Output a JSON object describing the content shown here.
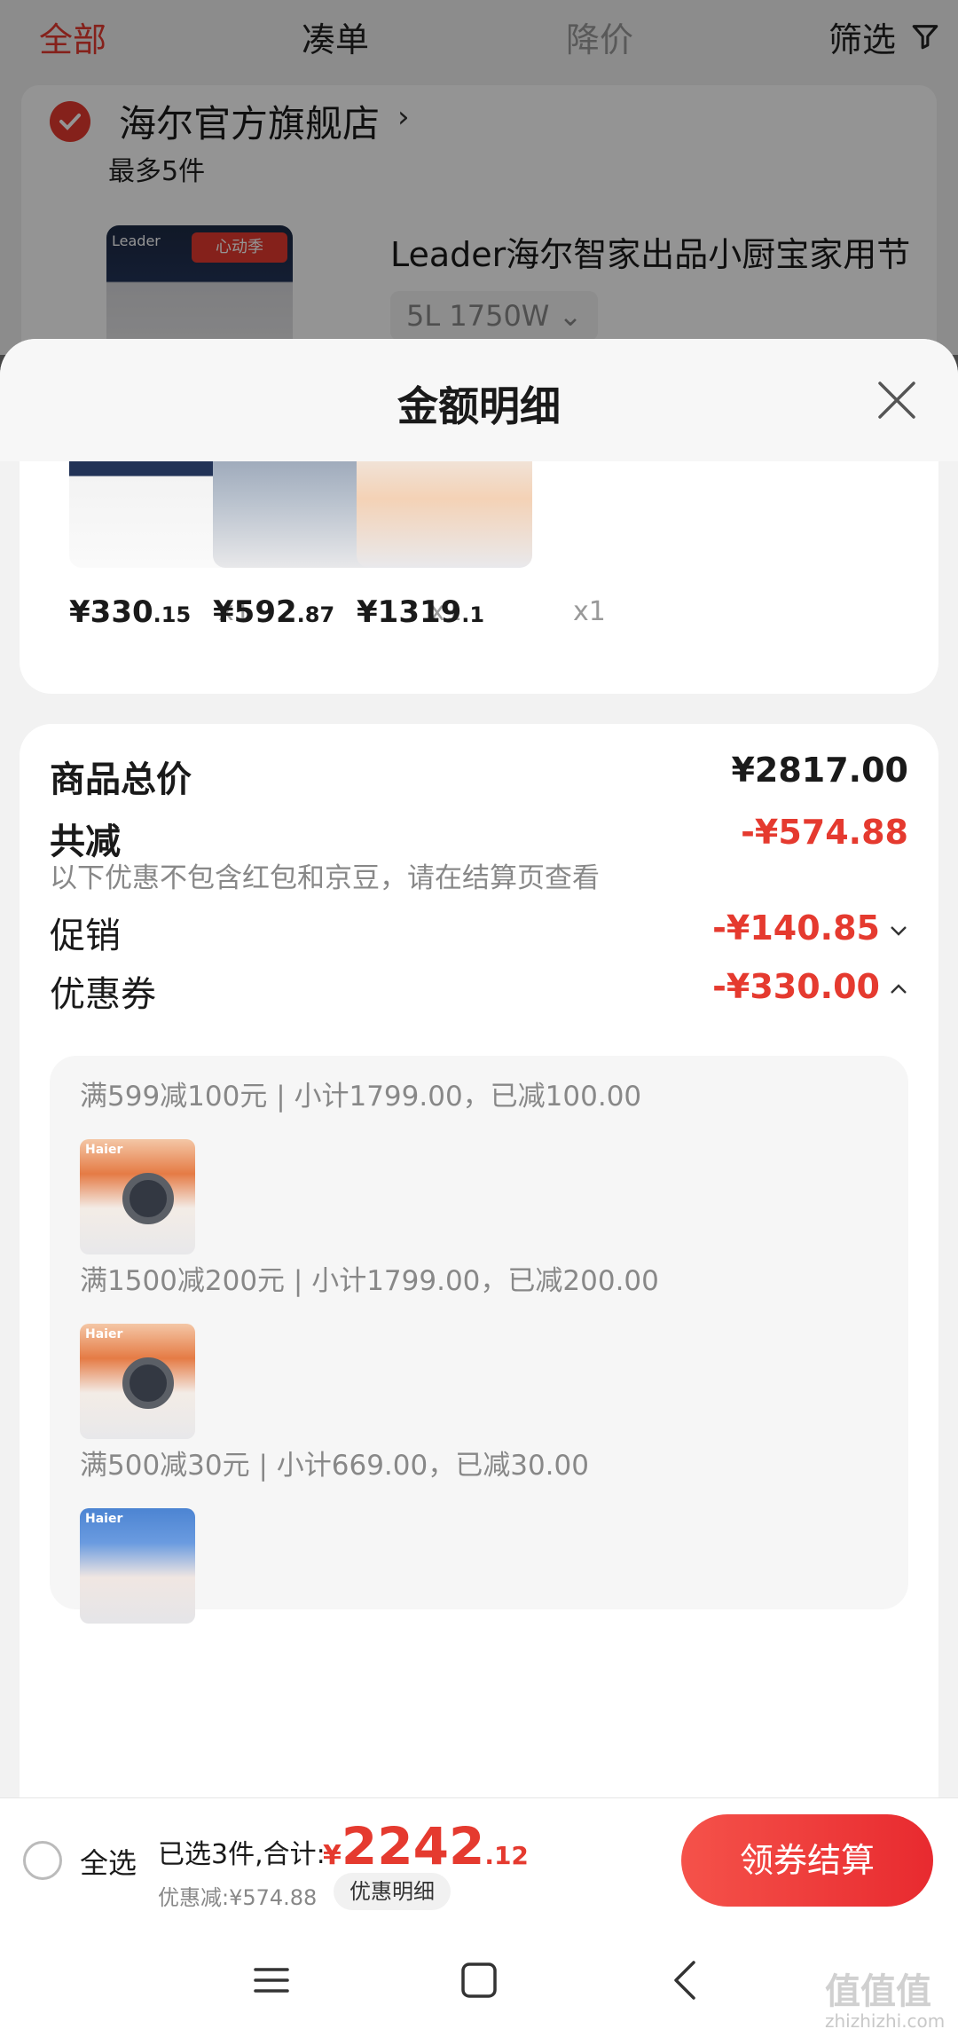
{
  "top_tabs": {
    "all": "全部",
    "combo": "凑单",
    "price_drop": "降价",
    "filter": "筛选"
  },
  "store": {
    "name": "海尔官方旗舰店",
    "arrow": "›",
    "limit": "最多5件",
    "product_title": "Leader海尔智家出品小厨宝家用节",
    "product_spec": "5L 1750W ⌄",
    "thumb_tag": "Leader",
    "thumb_badge": "心动季"
  },
  "sheet": {
    "title": "金额明细"
  },
  "items": [
    {
      "price_int": "¥330",
      "price_dec": ".15",
      "qty": "x1"
    },
    {
      "price_int": "¥592",
      "price_dec": ".87",
      "qty": "x1"
    },
    {
      "price_int": "¥1319",
      "price_dec": ".1",
      "qty": "x1"
    }
  ],
  "detail": {
    "goods_total_label": "商品总价",
    "goods_total_value": "¥2817.00",
    "total_reduce_label": "共减",
    "total_reduce_value": "-¥574.88",
    "note": "以下优惠不包含红包和京豆，请在结算页查看",
    "promo_label": "促销",
    "promo_value": "-¥140.85",
    "coupon_label": "优惠券",
    "coupon_value": "-¥330.00"
  },
  "coupons": [
    {
      "line": "满599减100元 | 小计1799.00，已减100.00",
      "img_label": "Haier"
    },
    {
      "line": "满1500减200元 | 小计1799.00，已减200.00",
      "img_label": "Haier"
    },
    {
      "line": "满500减30元 | 小计669.00，已减30.00",
      "img_label": "Haier"
    }
  ],
  "bottom": {
    "select_all": "全选",
    "selected": "已选3件,合计:",
    "yen": "¥",
    "total_int": "2242",
    "total_dec": ".12",
    "discount": "优惠减:¥574.88",
    "discount_detail": "优惠明细",
    "checkout": "领券结算"
  },
  "watermark": {
    "main": "值值值",
    "sub": "zhizhizhi.com"
  },
  "colors": {
    "accent": "#e53a2f",
    "muted": "#888888"
  }
}
